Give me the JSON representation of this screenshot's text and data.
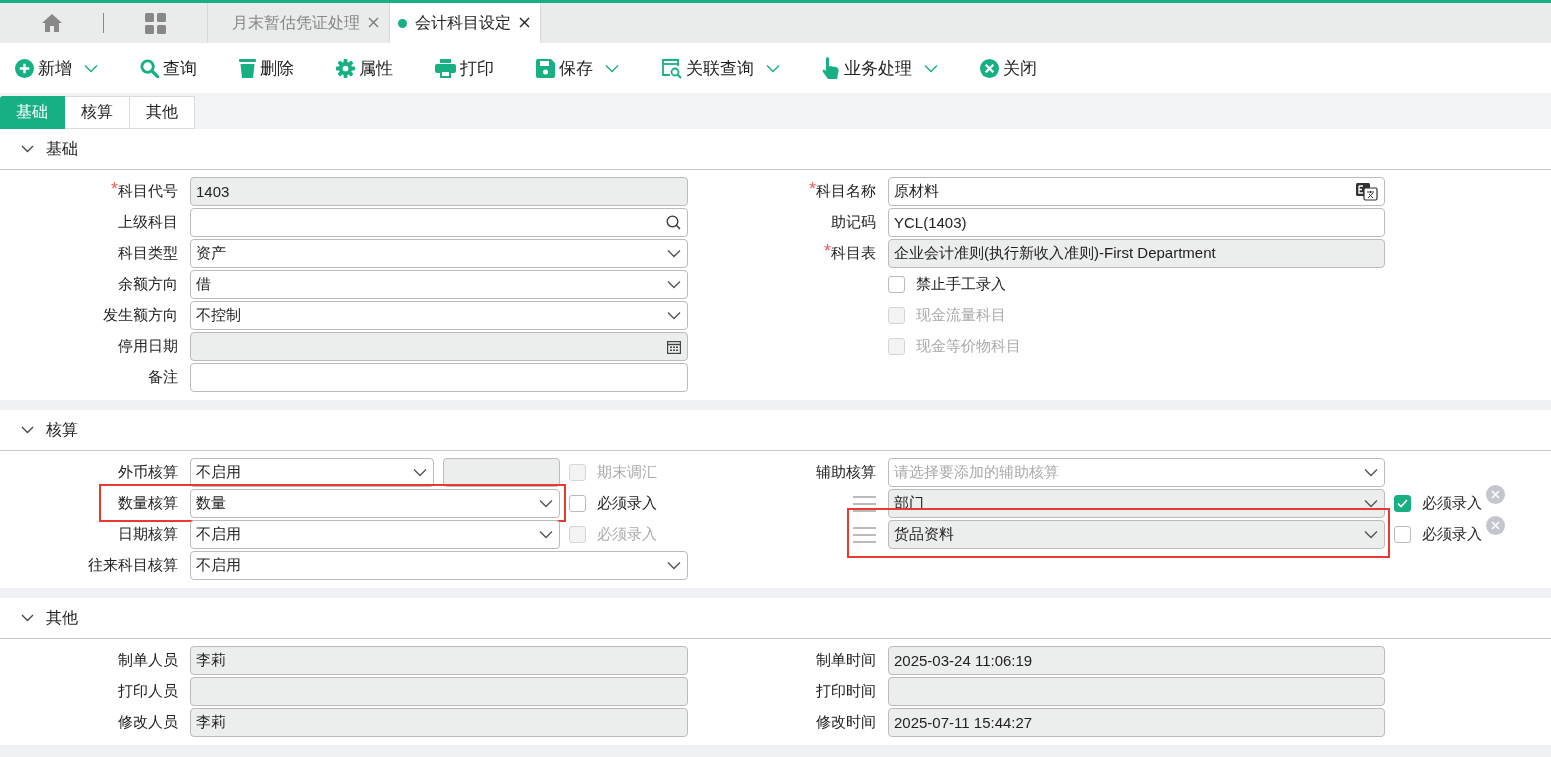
{
  "top_tabs": [
    {
      "label": "月末暂估凭证处理",
      "selected": false
    },
    {
      "label": "会计科目设定",
      "selected": true
    }
  ],
  "toolbar": [
    {
      "label": "新增",
      "has_menu": true
    },
    {
      "label": "查询",
      "has_menu": false
    },
    {
      "label": "删除",
      "has_menu": false
    },
    {
      "label": "属性",
      "has_menu": false
    },
    {
      "label": "打印",
      "has_menu": false
    },
    {
      "label": "保存",
      "has_menu": true
    },
    {
      "label": "关联查询",
      "has_menu": true
    },
    {
      "label": "业务处理",
      "has_menu": true
    },
    {
      "label": "关闭",
      "has_menu": false
    }
  ],
  "form_tabs": [
    {
      "label": "基础",
      "selected": true
    },
    {
      "label": "核算",
      "selected": false
    },
    {
      "label": "其他",
      "selected": false
    }
  ],
  "sections": [
    {
      "title": "基础",
      "expanded": true,
      "left": [
        {
          "kind": "text",
          "label": "科目代号",
          "required_mark": "*",
          "value": "1403",
          "disabled": true
        },
        {
          "kind": "search",
          "label": "上级科目",
          "disabled": false
        },
        {
          "kind": "select",
          "label": "科目类型",
          "value": "资产",
          "disabled": false
        },
        {
          "kind": "select",
          "label": "余额方向",
          "value": "借",
          "disabled": false
        },
        {
          "kind": "select",
          "label": "发生额方向",
          "value": "不控制",
          "disabled": false
        },
        {
          "kind": "date",
          "label": "停用日期",
          "disabled": true
        },
        {
          "kind": "text",
          "label": "备注",
          "disabled": false
        }
      ],
      "right": [
        {
          "kind": "translate",
          "label": "科目名称",
          "required_mark": "*",
          "value": "原材料",
          "disabled": false
        },
        {
          "kind": "text",
          "label": "助记码",
          "value": "YCL(1403)",
          "disabled": false
        },
        {
          "kind": "text",
          "label": "科目表",
          "required_mark": "*",
          "value": "企业会计准则(执行新收入准则)-First Department",
          "disabled": true
        },
        {
          "kind": "checkbox",
          "label": "禁止手工录入",
          "checked": false,
          "disabled": false
        },
        {
          "kind": "checkbox",
          "label": "现金流量科目",
          "checked": false,
          "disabled": true
        },
        {
          "kind": "checkbox",
          "label": "现金等价物科目",
          "checked": false,
          "disabled": true
        }
      ]
    },
    {
      "title": "核算",
      "expanded": true,
      "left": [
        {
          "kind": "select",
          "label": "外币核算",
          "value": "不启用",
          "disabled": false,
          "extra_box": {
            "disabled": true
          },
          "check": {
            "label": "期末调汇",
            "checked": false,
            "disabled": true
          }
        },
        {
          "kind": "select",
          "label": "数量核算",
          "value": "数量",
          "disabled": false,
          "highlighted": true,
          "check": {
            "label": "必须录入",
            "checked": false,
            "disabled": false
          }
        },
        {
          "kind": "select",
          "label": "日期核算",
          "value": "不启用",
          "disabled": false,
          "check": {
            "label": "必须录入",
            "checked": false,
            "disabled": true
          }
        },
        {
          "kind": "select",
          "label": "往来科目核算",
          "value": "不启用",
          "disabled": false
        }
      ],
      "right": [
        {
          "kind": "select",
          "label": "辅助核算",
          "placeholder": "请选择要添加的辅助核算",
          "disabled": false
        },
        {
          "kind": "aux",
          "value": "部门",
          "disabled": true,
          "check": {
            "label": "必须录入",
            "checked": true,
            "disabled": false
          }
        },
        {
          "kind": "aux",
          "value": "货品资料",
          "disabled": true,
          "highlighted": true,
          "check": {
            "label": "必须录入",
            "checked": false,
            "disabled": false
          }
        }
      ]
    },
    {
      "title": "其他",
      "expanded": true,
      "left": [
        {
          "kind": "text",
          "label": "制单人员",
          "value": "李莉",
          "disabled": true
        },
        {
          "kind": "text",
          "label": "打印人员",
          "disabled": true
        },
        {
          "kind": "text",
          "label": "修改人员",
          "value": "李莉",
          "disabled": true
        }
      ],
      "right": [
        {
          "kind": "text",
          "label": "制单时间",
          "value": "2025-03-24 11:06:19",
          "disabled": true
        },
        {
          "kind": "text",
          "label": "打印时间",
          "disabled": true
        },
        {
          "kind": "text",
          "label": "修改时间",
          "value": "2025-07-11 15:44:27",
          "disabled": true
        }
      ]
    }
  ]
}
